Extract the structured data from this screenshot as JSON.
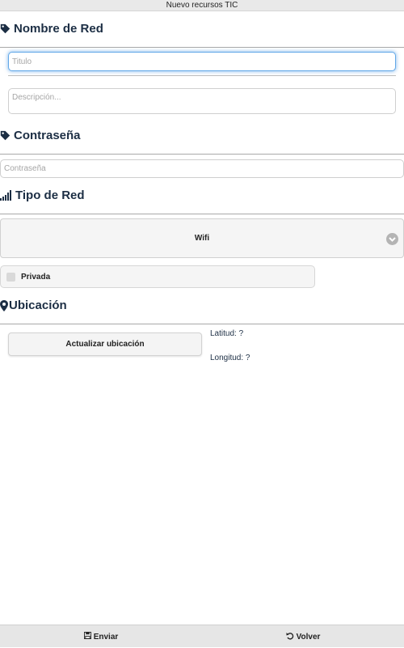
{
  "window": {
    "title": "Nuevo recursos TIC"
  },
  "network_name": {
    "heading": "Nombre de Red",
    "icon": "tag-icon",
    "title_placeholder": "Titulo",
    "title_value": "",
    "description_placeholder": "Descripción...",
    "description_value": ""
  },
  "password": {
    "heading": "Contraseña",
    "icon": "tag-icon",
    "placeholder": "Contraseña",
    "value": ""
  },
  "network_type": {
    "heading": "Tipo de Red",
    "icon": "signal-icon",
    "selected": "Wifi",
    "options": [
      "Wifi"
    ]
  },
  "private_toggle": {
    "label": "Privada",
    "checked": false
  },
  "location": {
    "heading": "Ubicación",
    "icon": "map-marker-icon",
    "update_button": "Actualizar ubicación",
    "latitude_text": "Latitud: ?",
    "longitude_text": "Longitud: ?"
  },
  "footer": {
    "send_label": "Enviar",
    "send_icon": "floppy-disk-icon",
    "back_label": "Volver",
    "back_icon": "undo-icon"
  },
  "colors": {
    "heading": "#1c2e44",
    "focus": "#62a8e8",
    "control_bg": "#f5f5f5",
    "footer_bg": "#e6e6e6"
  }
}
